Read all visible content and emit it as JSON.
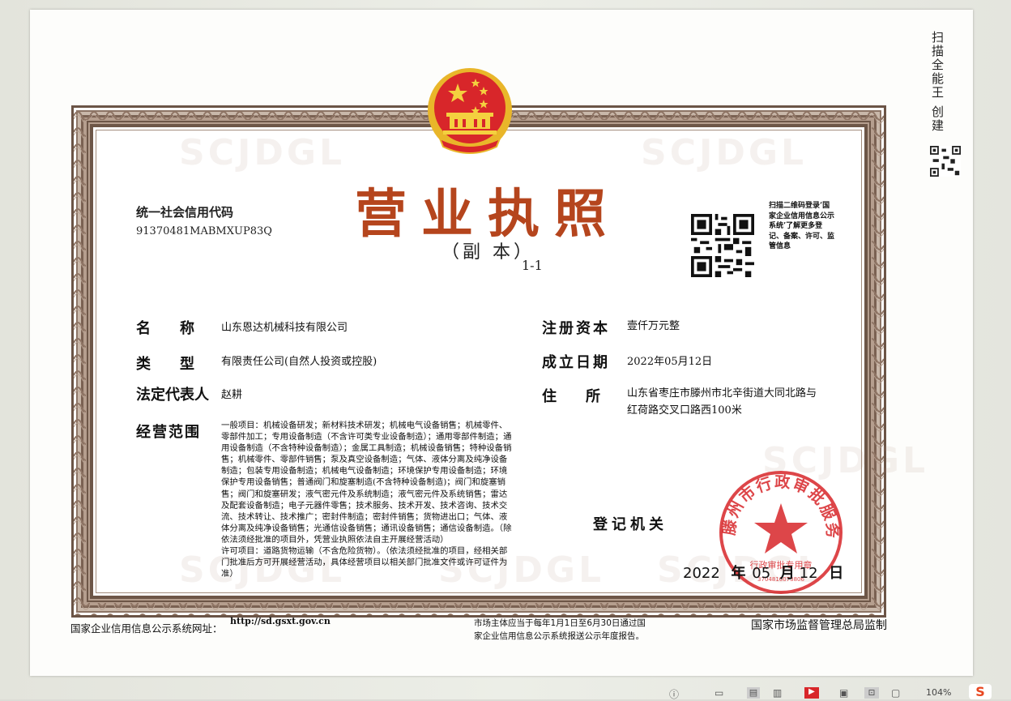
{
  "document": {
    "title": "营业执照",
    "subtitle": "（副 本）",
    "copy_no": "1-1",
    "credit_code_label": "统一社会信用代码",
    "credit_code": "91370481MABMXUP83Q",
    "qr_note": "扫描二维码登录‘国家企业信用信息公示系统’了解更多登记、备案、许可、监管信息",
    "fields": {
      "name_label": "名　　称",
      "name": "山东恩达机械科技有限公司",
      "type_label": "类　　型",
      "type": "有限责任公司(自然人投资或控股)",
      "rep_label": "法定代表人",
      "rep": "赵耕",
      "scope_label": "经营范围",
      "scope": "一般项目：机械设备研发；新材料技术研发；机械电气设备销售；机械零件、零部件加工；专用设备制造（不含许可类专业设备制造）；通用零部件制造；通用设备制造（不含特种设备制造）；金属工具制造；机械设备销售；特种设备销售；机械零件、零部件销售；泵及真空设备制造；气体、液体分离及纯净设备制造；包装专用设备制造；机械电气设备制造；环境保护专用设备制造；环境保护专用设备销售；普通阀门和旋塞制造(不含特种设备制造)；阀门和旋塞销售；阀门和旋塞研发；液气密元件及系统制造；液气密元件及系统销售；雷达及配套设备制造；电子元器件零售；技术服务、技术开发、技术咨询、技术交流、技术转让、技术推广；密封件制造；密封件销售；货物进出口；气体、液体分离及纯净设备销售；光通信设备销售；通讯设备销售；通信设备制造。（除依法须经批准的项目外，凭营业执照依法自主开展经营活动）\n许可项目：道路货物运输（不含危险货物）。（依法须经批准的项目，经相关部门批准后方可开展经营活动，具体经营项目以相关部门批准文件或许可证件为准）",
      "capital_label": "注册资本",
      "capital": "壹仟万元整",
      "date_label": "成立日期",
      "date": "2022年05月12日",
      "address_label": "住　　所",
      "address_line1": "山东省枣庄市滕州市北辛街道大同北路与",
      "address_line2": "红荷路交叉口路西100米",
      "authority_label": "登记机关",
      "issue_year": "2022",
      "issue_nian": "年",
      "issue_month": "05",
      "issue_yue": "月",
      "issue_day": "12",
      "issue_ri": "日"
    },
    "seal": {
      "ring_text": "滕州市行政审批服务局",
      "inner_text": "行政审批专用章",
      "number": "3704816073806",
      "color": "#d8262a"
    },
    "watermark": "SCJDGL",
    "footer": {
      "site_label": "国家企业信用信息公示系统网址：",
      "site_url": "http://sd.gsxt.gov.cn",
      "note_line1": "市场主体应当于每年1月1日至6月30日通过国",
      "note_line2": "家企业信用信息公示系统报送公示年度报告。",
      "supervisor": "国家市场监督管理总局监制"
    }
  },
  "side_note": "扫描全能王 创建",
  "toolbar": {
    "zoom": "104%"
  },
  "colors": {
    "title": "#b5451d",
    "border": "#6b5446",
    "emblem_red": "#d8262a",
    "emblem_gold": "#e9b62a"
  }
}
